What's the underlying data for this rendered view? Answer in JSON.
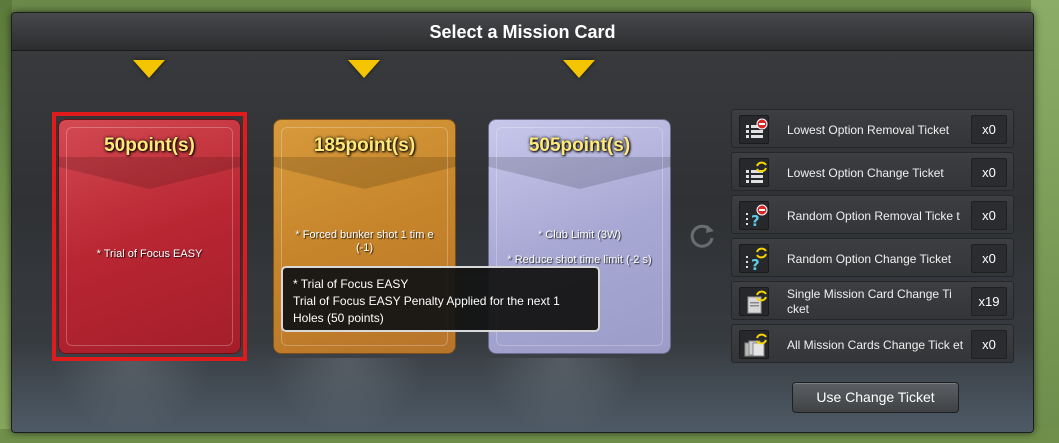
{
  "dialog": {
    "title": "Select a Mission Card"
  },
  "cards": [
    {
      "points": "50point(s)",
      "desc": "* Trial of Focus EASY",
      "selected": true,
      "color": "#c0303c"
    },
    {
      "points": "185point(s)",
      "desc": "* Forced bunker shot 1 tim e (-1)",
      "color": "#cf8c30"
    },
    {
      "points": "505point(s)",
      "desc1": "* Club Limit (3W)",
      "desc2": "* Reduce shot time limit (-2 s)",
      "color": "#b0b0dc"
    }
  ],
  "tooltip": {
    "line1": "* Trial of Focus EASY",
    "line2": "Trial of Focus EASY Penalty Applied for the next 1",
    "line3": "Holes (50 points)"
  },
  "tickets": [
    {
      "label": "Lowest Option Removal Ticket",
      "count": "x0",
      "icon": "list-remove-icon"
    },
    {
      "label": "Lowest Option Change Ticket",
      "count": "x0",
      "icon": "list-change-icon"
    },
    {
      "label": "Random Option Removal Ticke t",
      "count": "x0",
      "icon": "random-remove-icon"
    },
    {
      "label": "Random Option Change Ticket",
      "count": "x0",
      "icon": "random-change-icon"
    },
    {
      "label": "Single Mission Card Change Ti cket",
      "count": "x19",
      "icon": "single-card-change-icon"
    },
    {
      "label": "All Mission Cards Change Tick et",
      "count": "x0",
      "icon": "all-cards-change-icon"
    }
  ],
  "actions": {
    "use_change_ticket": "Use Change Ticket"
  },
  "colors": {
    "accent": "#f5c400",
    "selected_border": "#e01b1b",
    "points_text": "#ffe97a"
  }
}
